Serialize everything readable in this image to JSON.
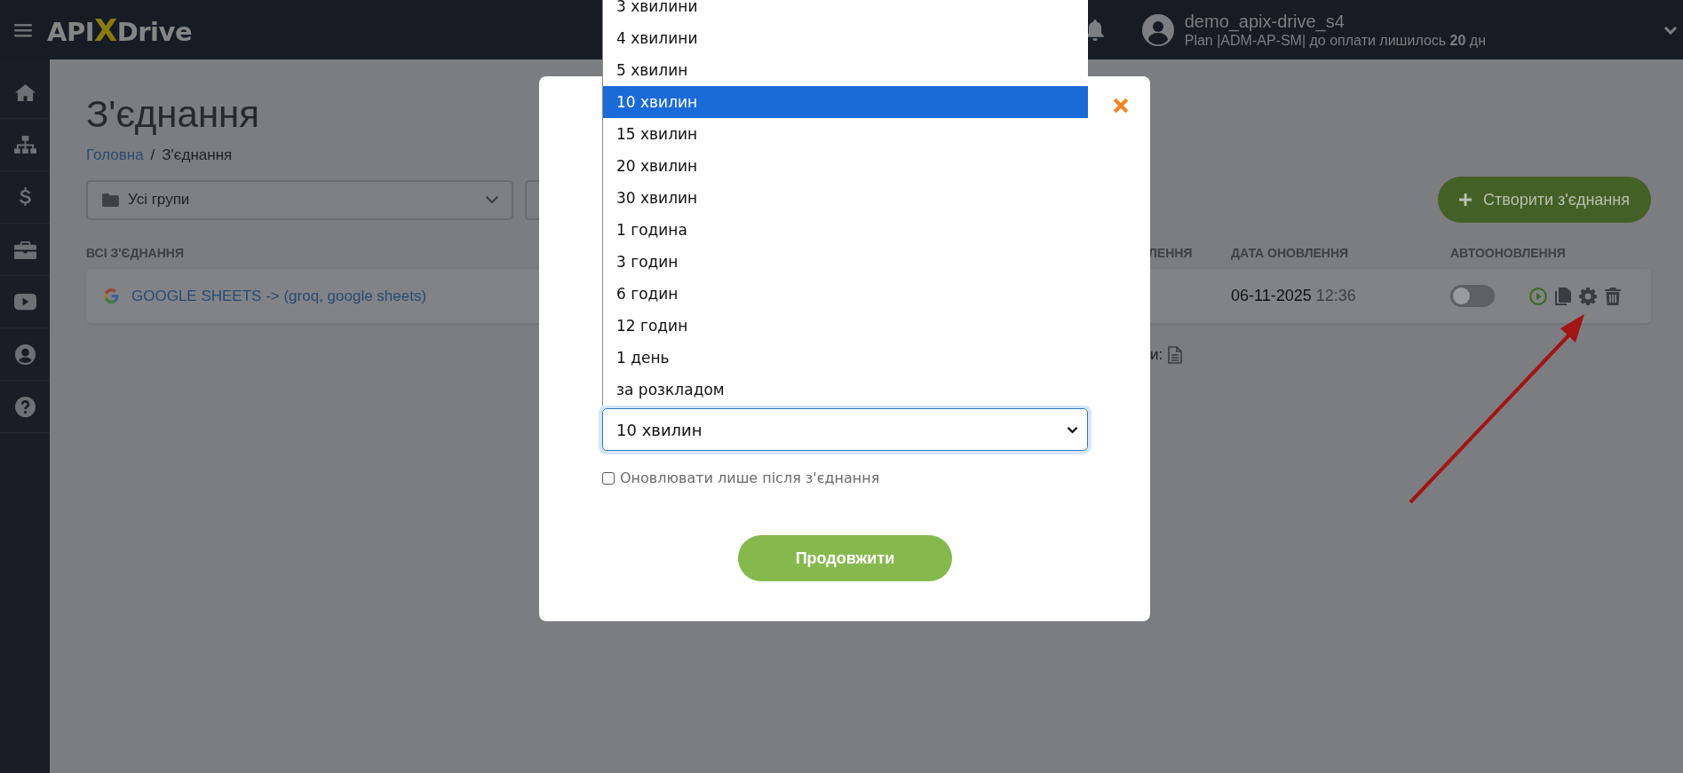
{
  "topbar": {
    "logo": [
      "API",
      "X",
      "Drive"
    ],
    "user": {
      "name": "demo_apix-drive_s4",
      "plan": "Plan |ADM-AP-SM| до оплати лишилось **20** дн"
    }
  },
  "sidebar": {
    "items": [
      {
        "kind": "home"
      },
      {
        "kind": "sitemap"
      },
      {
        "kind": "dollar"
      },
      {
        "kind": "briefcase"
      },
      {
        "kind": "video"
      },
      {
        "kind": "user"
      },
      {
        "kind": "help"
      }
    ]
  },
  "page": {
    "title": "З'єднання",
    "breadcrumb": [
      "Головна",
      "/",
      "З'єднання"
    ],
    "group_filter": {
      "value": "Усі групи"
    },
    "create_button": "Створити з'єднання",
    "table": {
      "columns": [
        "ВСІ З'ЄДНАННЯ",
        "ЛЕННЯ",
        "ДАТА ОНОВЛЕННЯ",
        "АВТООНОВЛЕННЯ"
      ],
      "rows": [
        {
          "name": "GOOGLE SHEETS -> (groq, google sheets)",
          "date": "06-11-2025",
          "time": "12:36",
          "auto_update": false
        }
      ]
    },
    "footer": "и:"
  },
  "modal": {
    "interval_select": {
      "value": "10 хвилин",
      "options": [
        {
          "label": "3 хвилини",
          "selected": false
        },
        {
          "label": "4 хвилини",
          "selected": false
        },
        {
          "label": "5 хвилин",
          "selected": false
        },
        {
          "label": "10 хвилин",
          "selected": true
        },
        {
          "label": "15 хвилин",
          "selected": false
        },
        {
          "label": "20 хвилин",
          "selected": false
        },
        {
          "label": "30 хвилин",
          "selected": false
        },
        {
          "label": "1 година",
          "selected": false
        },
        {
          "label": "3 годин",
          "selected": false
        },
        {
          "label": "6 годин",
          "selected": false
        },
        {
          "label": "12 годин",
          "selected": false
        },
        {
          "label": "1 день",
          "selected": false
        },
        {
          "label": "за розкладом",
          "selected": false
        }
      ]
    },
    "only_after_checkbox": {
      "label": "Оновлювати лише після з'єднання",
      "checked": false
    },
    "continue_button": "Продовжити"
  }
}
